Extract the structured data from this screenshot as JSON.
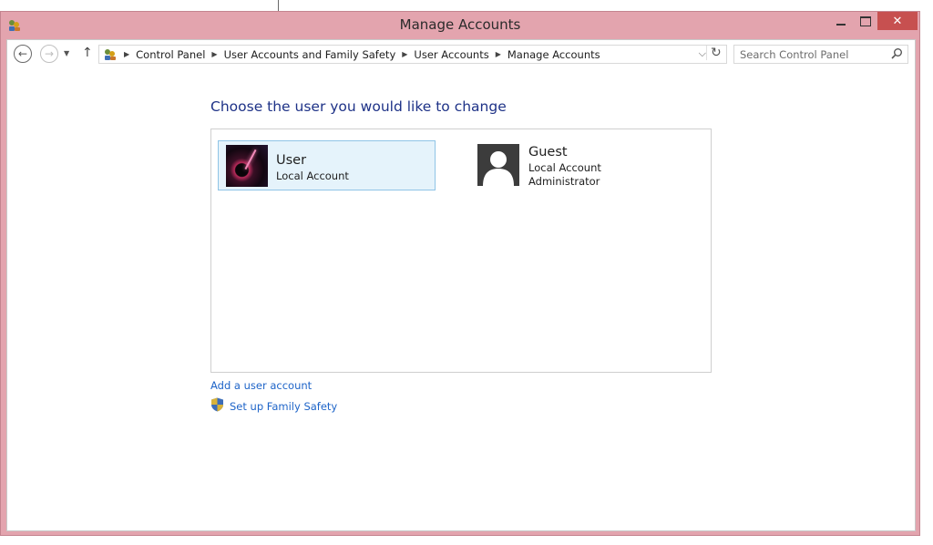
{
  "window": {
    "title": "Manage Accounts",
    "close_glyph": "✕"
  },
  "nav": {
    "back_glyph": "←",
    "forward_glyph": "→",
    "recent_glyph": "▼",
    "up_glyph": "↑"
  },
  "breadcrumbs": [
    "Control Panel",
    "User Accounts and Family Safety",
    "User Accounts",
    "Manage Accounts"
  ],
  "address": {
    "separator_glyph": "▶",
    "dropdown_glyph": "⌵",
    "refresh_glyph": "↻"
  },
  "search": {
    "placeholder": "Search Control Panel"
  },
  "main": {
    "heading": "Choose the user you would like to change",
    "accounts": [
      {
        "name": "User",
        "details": [
          "Local Account"
        ],
        "selected": true
      },
      {
        "name": "Guest",
        "details": [
          "Local Account",
          "Administrator"
        ],
        "selected": false
      }
    ],
    "links": {
      "add_account": "Add a user account",
      "family_safety": "Set up Family Safety"
    }
  },
  "colors": {
    "window_frame": "#e3a4ae",
    "close_button": "#c75050",
    "heading": "#1e3287",
    "link": "#1e64c8",
    "selection_bg": "#e5f3fb",
    "selection_border": "#8fc4e6"
  },
  "icons": [
    "control-panel-icon",
    "back-arrow-icon",
    "forward-arrow-icon",
    "up-arrow-icon",
    "refresh-icon",
    "search-icon",
    "shield-icon"
  ]
}
